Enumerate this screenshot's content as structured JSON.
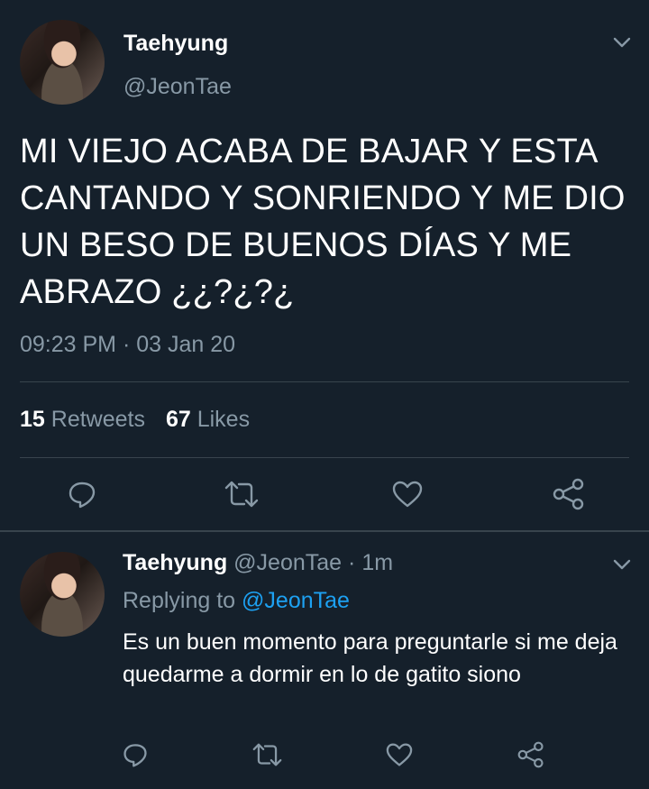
{
  "main_tweet": {
    "author_name": "Taehyung",
    "author_handle": "@JeonTae",
    "text": "MI VIEJO ACABA DE BAJAR Y ESTA CANTANDO Y SONRIENDO Y ME DIO UN BESO DE BUENOS DÍAS Y ME ABRAZO ¿¿?¿?¿",
    "timestamp": "09:23 PM · 03 Jan 20",
    "retweets_count": "15",
    "retweets_label": "Retweets",
    "likes_count": "67",
    "likes_label": "Likes"
  },
  "reply": {
    "author_name": "Taehyung",
    "author_handle": "@JeonTae",
    "separator": "·",
    "time": "1m",
    "replying_prefix": "Replying to",
    "replying_handle": "@JeonTae",
    "text": "Es un buen momento para preguntarle si me deja quedarme a dormir en lo de gatito siono"
  },
  "icons": [
    "chevron-down-icon",
    "reply-icon",
    "retweet-icon",
    "like-icon",
    "share-icon"
  ],
  "colors": {
    "background": "#15202b",
    "text": "#ffffff",
    "muted": "#8899a6",
    "link": "#1da1f2",
    "divider": "#38444d"
  }
}
